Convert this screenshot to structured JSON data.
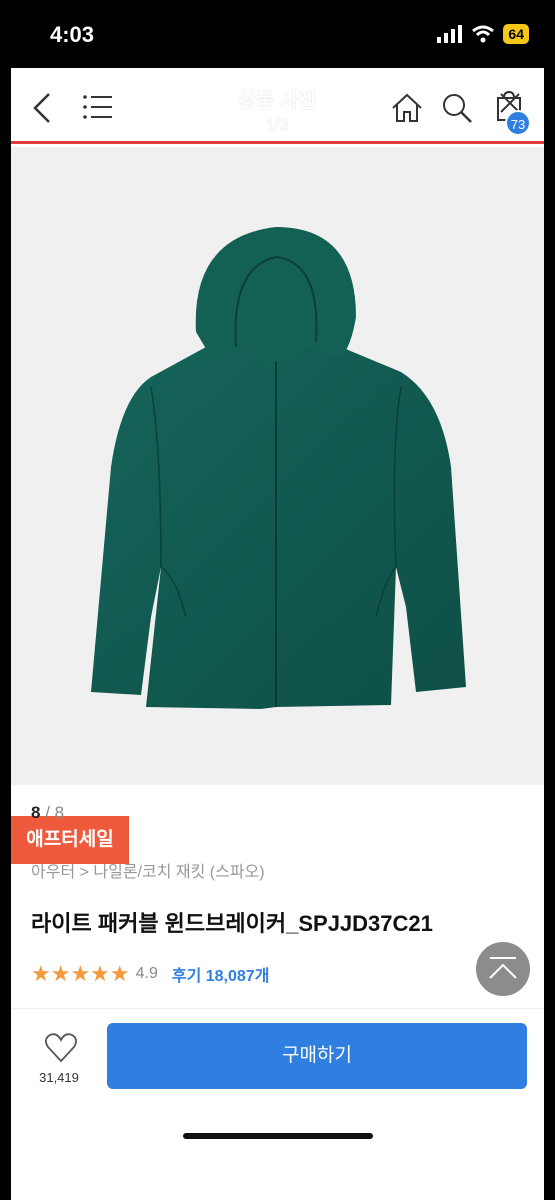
{
  "status_bar": {
    "time": "4:03",
    "battery": "64"
  },
  "header": {
    "title": "상품 사진",
    "counter": "1/3",
    "cart_badge": "73"
  },
  "photo": {
    "sale_tag": "애프터세일"
  },
  "info": {
    "photo_index_current": "8",
    "photo_index_sep": " / ",
    "photo_index_total": "8",
    "breadcrumb": "아우터 > 나일론/코치 재킷 (스파오)",
    "product_name": "라이트 패커블 윈드브레이커_SPJJD37C21",
    "stars": "★★★★★",
    "rating": "4.9",
    "reviews": "후기 18,087개"
  },
  "bottom": {
    "wish_count": "31,419",
    "buy_label": "구매하기"
  },
  "colors": {
    "accent_blue": "#2f7fe0",
    "sale_orange": "#f05a3c",
    "star_orange": "#f39a3c",
    "header_red": "#e53b3b",
    "jacket_green": "#11574d"
  }
}
